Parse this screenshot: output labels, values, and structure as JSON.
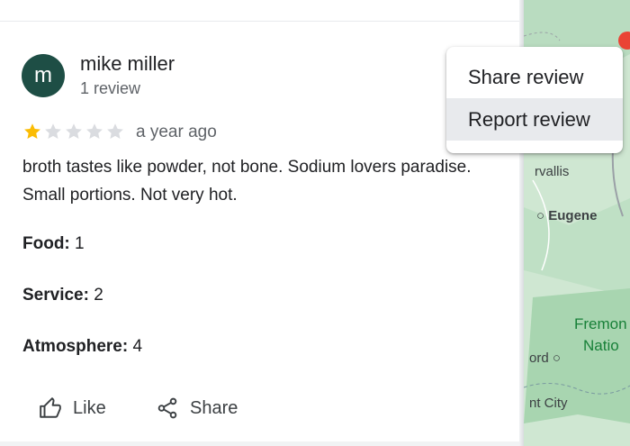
{
  "review": {
    "avatar_letter": "m",
    "reviewer_name": "mike miller",
    "review_count": "1 review",
    "rating": 1,
    "max_rating": 5,
    "time": "a year ago",
    "text": "broth tastes like powder, not bone. Sodium lovers paradise. Small portions. Not very hot.",
    "attributes": [
      {
        "label": "Food:",
        "value": "1"
      },
      {
        "label": "Service:",
        "value": "2"
      },
      {
        "label": "Atmosphere:",
        "value": "4"
      }
    ]
  },
  "actions": {
    "like_label": "Like",
    "share_label": "Share"
  },
  "menu": {
    "items": [
      {
        "label": "Share review"
      },
      {
        "label": "Report review"
      }
    ]
  },
  "map": {
    "labels": [
      "rvallis",
      "Eugene",
      "Fremon",
      "Natio",
      "ord",
      "nt City"
    ]
  },
  "colors": {
    "avatar_bg": "#1e4e45",
    "star_filled": "#fbbc04",
    "star_empty": "#dadce0",
    "map_green": "#cfe7d2"
  }
}
